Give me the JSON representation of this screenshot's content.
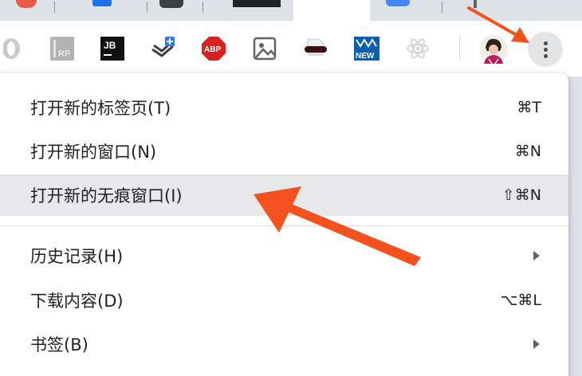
{
  "tabs": [
    {
      "favicon_color": "#ea4335"
    },
    {
      "favicon_color": "#1a73e8"
    },
    {
      "favicon_color": "#3c4043"
    },
    {
      "favicon_color": "#202124"
    },
    {
      "favicon_color": "#4285f4"
    },
    {
      "favicon_color": "#5f6368"
    }
  ],
  "toolbar": {
    "extensions": [
      {
        "name": "opera-ext-icon"
      },
      {
        "name": "rp-ext-icon",
        "text": "RP"
      },
      {
        "name": "jetbrains-ext-icon",
        "text": "JB"
      },
      {
        "name": "clip-plus-ext-icon"
      },
      {
        "name": "adblock-plus-ext-icon",
        "text": "ABP"
      },
      {
        "name": "image-ext-icon"
      },
      {
        "name": "incognito-mask-ext-icon"
      },
      {
        "name": "new-badge-ext-icon",
        "text": "NEW"
      },
      {
        "name": "react-devtools-ext-icon"
      }
    ],
    "menu_button_icon": "more-vert-icon"
  },
  "menu": {
    "items": [
      {
        "label": "打开新的标签页(T)",
        "shortcut": "⌘T"
      },
      {
        "label": "打开新的窗口(N)",
        "shortcut": "⌘N"
      },
      {
        "label": "打开新的无痕窗口(I)",
        "shortcut": "⇧⌘N",
        "highlighted": true
      },
      {
        "label": "历史记录(H)",
        "submenu": true
      },
      {
        "label": "下载内容(D)",
        "shortcut": "⌥⌘L"
      },
      {
        "label": "书签(B)",
        "submenu": true
      }
    ]
  },
  "colors": {
    "annotation_arrow": "#f4511e",
    "highlight_row": "#e8e8ea",
    "abp_red": "#d9201f"
  }
}
